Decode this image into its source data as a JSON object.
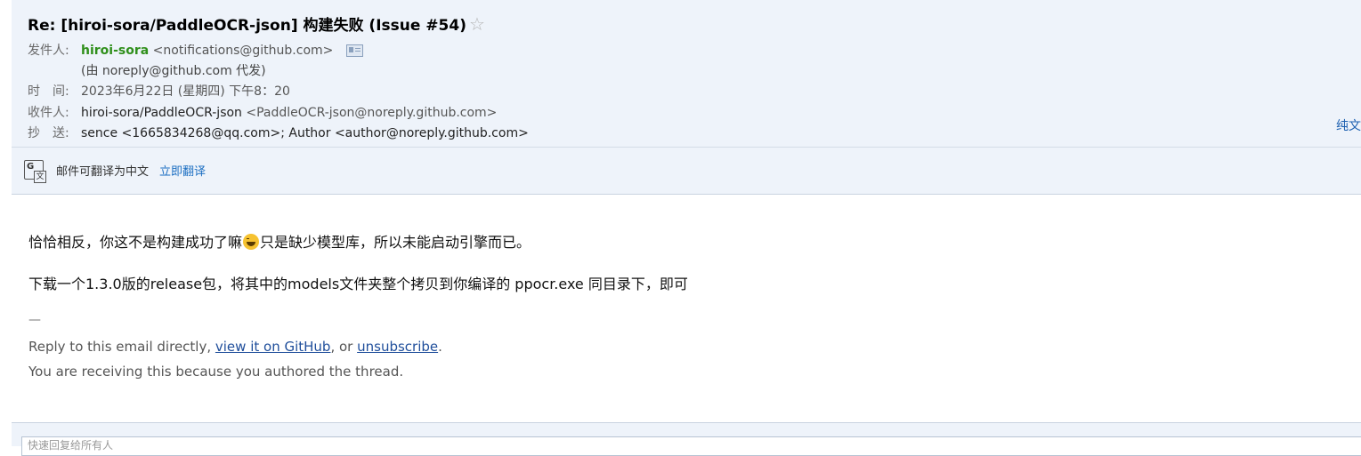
{
  "subject": "Re: [hiroi-sora/PaddleOCR-json] 构建失败 (Issue #54)",
  "star_icon": "star-outline-icon",
  "from": {
    "label": "发件人:",
    "name": "hiroi-sora",
    "address": "<notifications@github.com>",
    "via": "(由 noreply@github.com 代发)"
  },
  "time": {
    "label": "时　间:",
    "value": "2023年6月22日 (星期四) 下午8：20"
  },
  "to": {
    "label": "收件人:",
    "value": "hiroi-sora/PaddleOCR-json",
    "address": "<PaddleOCR-json@noreply.github.com>"
  },
  "cc": {
    "label": "抄　送:",
    "value": "sence <1665834268@qq.com>; Author <author@noreply.github.com>"
  },
  "plaintext_label": "纯文",
  "translate": {
    "text": "邮件可翻译为中文",
    "link": "立即翻译"
  },
  "body": {
    "line1_before": "恰恰相反，你这不是构建成功了嘛",
    "line1_after": "只是缺少模型库，所以未能启动引擎而已。",
    "line2": "下载一个1.3.0版的release包，将其中的models文件夹整个拷贝到你编译的 ppocr.exe 同目录下，即可"
  },
  "signature": {
    "dash": "—",
    "reply_prefix": "Reply to this email directly, ",
    "view_link": "view it on GitHub",
    "or_text": ", or ",
    "unsubscribe_link": "unsubscribe",
    "period": ".",
    "receiving": "You are receiving this because you authored the thread."
  },
  "reply_placeholder": "快速回复给所有人"
}
